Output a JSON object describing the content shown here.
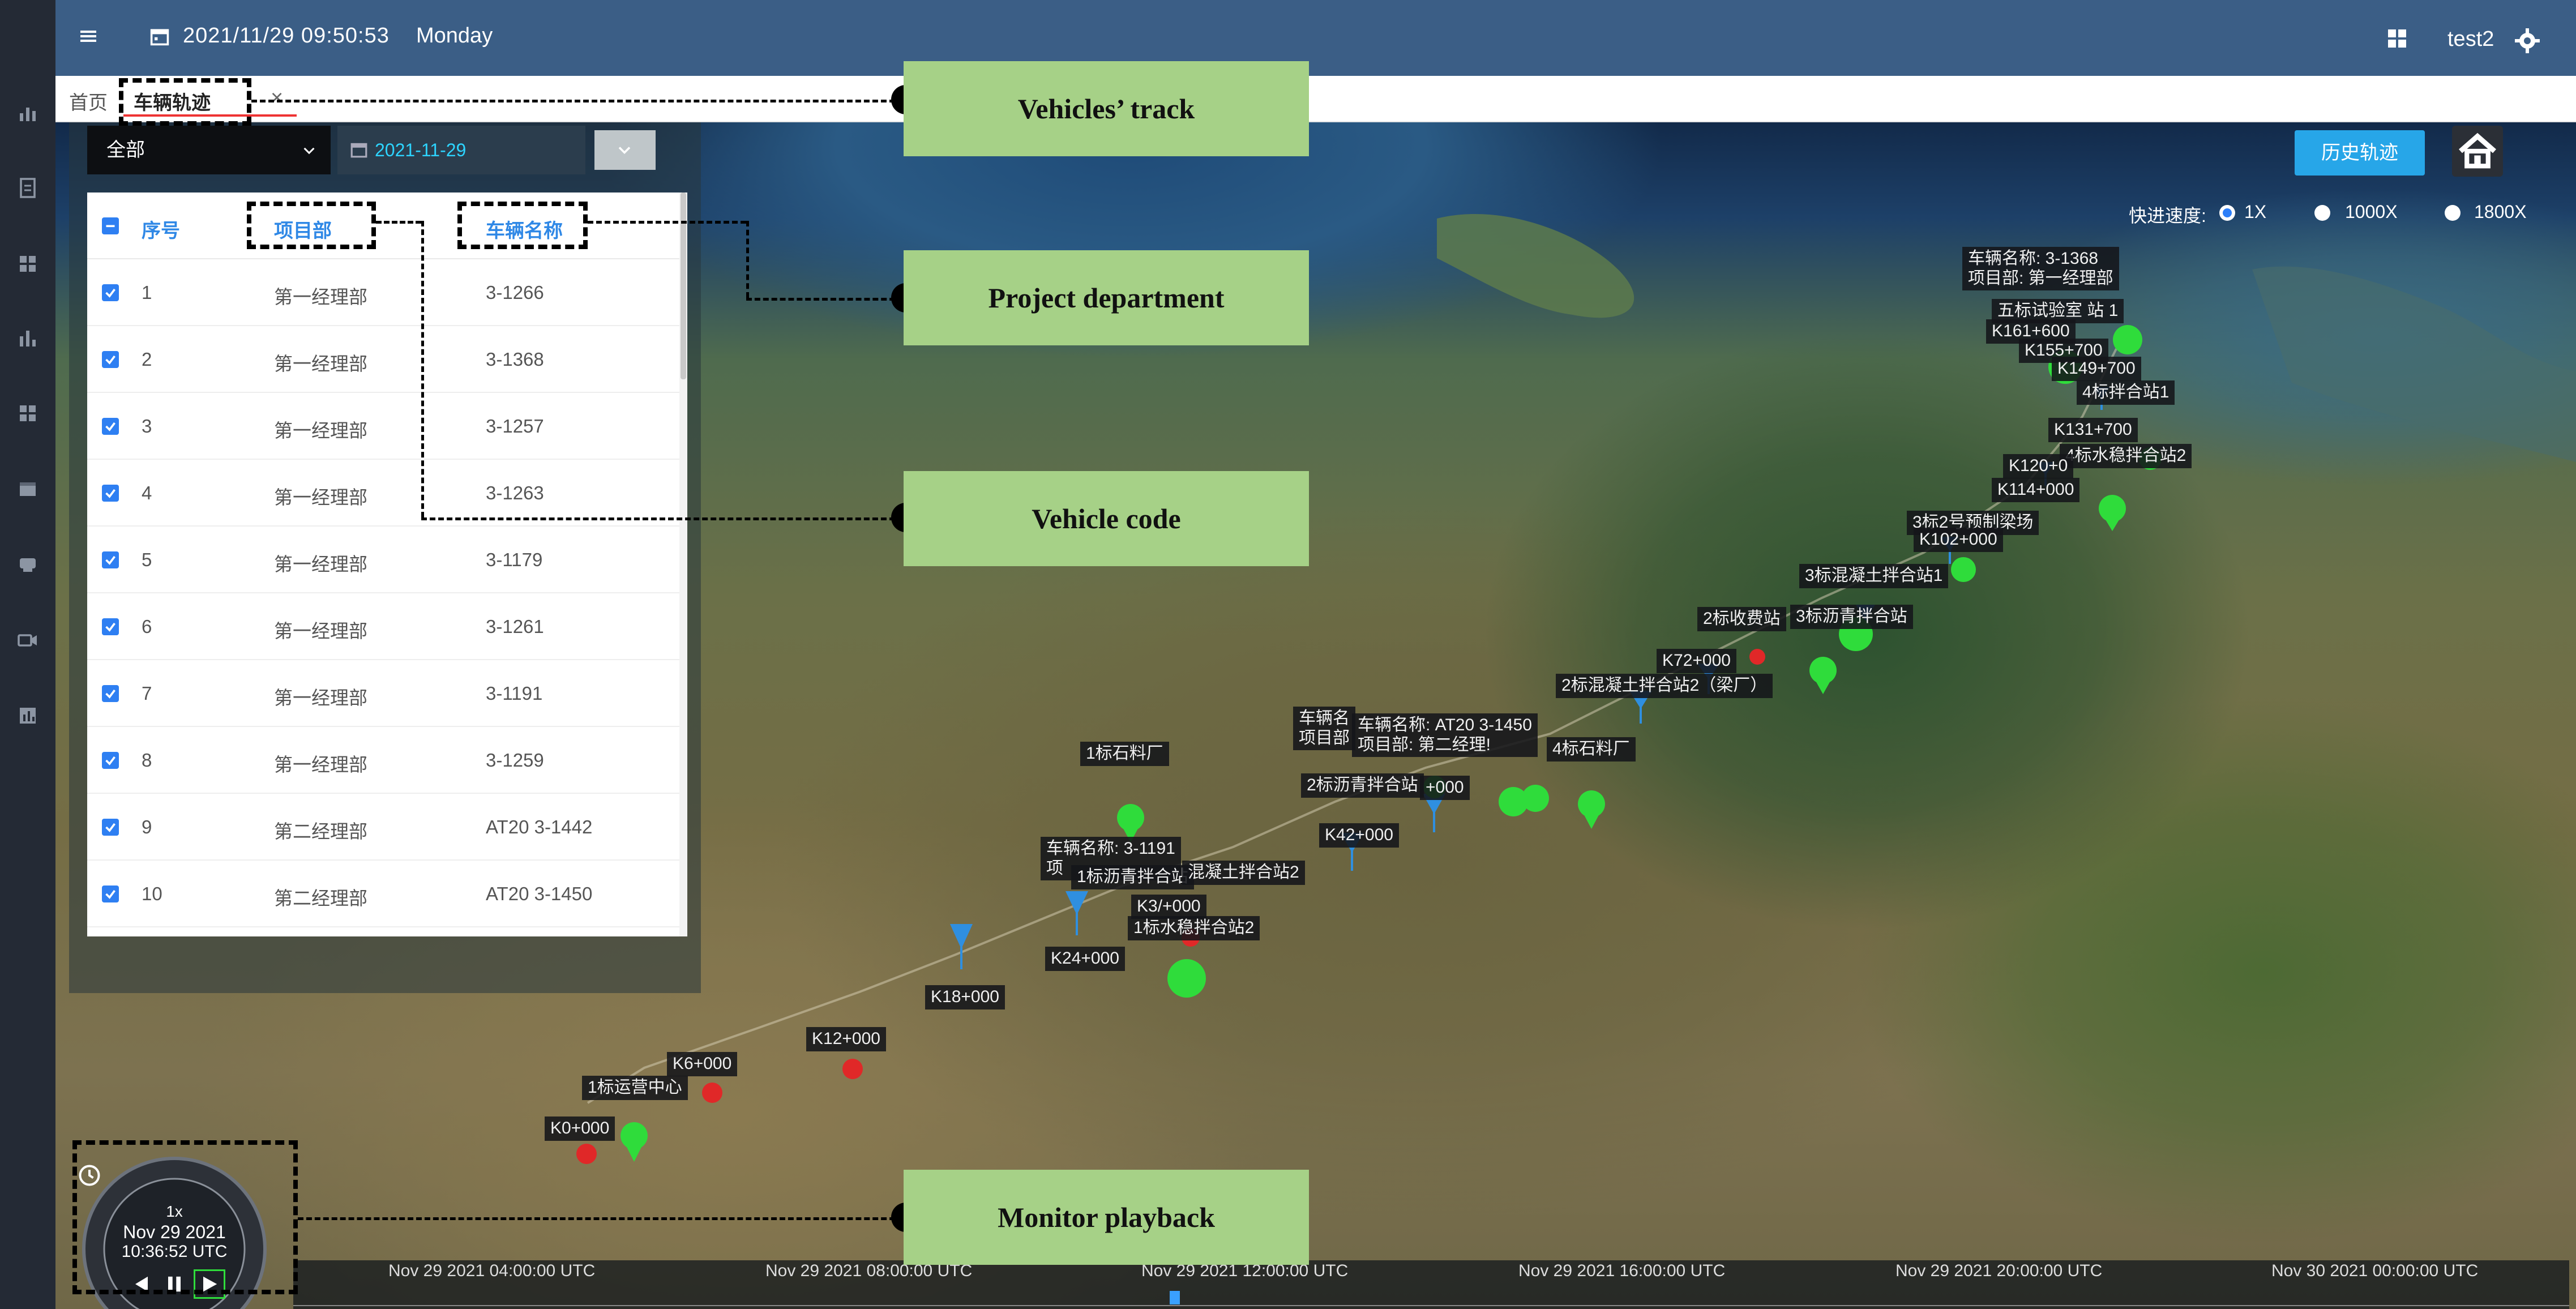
{
  "topbar": {
    "datetime": "2021/11/29  09:50:53",
    "weekday": "Monday",
    "user": "test2"
  },
  "tabs": {
    "home": "首页",
    "active": "车辆轨迹"
  },
  "filter": {
    "select_value": "全部",
    "date_value": "2021-11-29"
  },
  "map_controls": {
    "history_button": "历史轨迹",
    "speed_label": "快进速度:",
    "speed_options": [
      "1X",
      "1000X",
      "1800X"
    ],
    "speed_selected": "1X"
  },
  "table": {
    "headers": {
      "index": "序号",
      "department": "项目部",
      "vehicle": "车辆名称"
    },
    "rows": [
      {
        "index": "1",
        "department": "第一经理部",
        "vehicle": "3-1266"
      },
      {
        "index": "2",
        "department": "第一经理部",
        "vehicle": "3-1368"
      },
      {
        "index": "3",
        "department": "第一经理部",
        "vehicle": "3-1257"
      },
      {
        "index": "4",
        "department": "第一经理部",
        "vehicle": "3-1263"
      },
      {
        "index": "5",
        "department": "第一经理部",
        "vehicle": "3-1179"
      },
      {
        "index": "6",
        "department": "第一经理部",
        "vehicle": "3-1261"
      },
      {
        "index": "7",
        "department": "第一经理部",
        "vehicle": "3-1191"
      },
      {
        "index": "8",
        "department": "第一经理部",
        "vehicle": "3-1259"
      },
      {
        "index": "9",
        "department": "第二经理部",
        "vehicle": "AT20 3-1442"
      },
      {
        "index": "10",
        "department": "第二经理部",
        "vehicle": "AT20 3-1450"
      }
    ]
  },
  "playback": {
    "speed": "1x",
    "date": "Nov 29 2021",
    "time": "10:36:52 UTC"
  },
  "timeline": {
    "labels": [
      "Nov 29 2021 04:00:00 UTC",
      "Nov 29 2021 08:00:00 UTC",
      "Nov 29 2021 12:00:00 UTC",
      "Nov 29 2021 16:00:00 UTC",
      "Nov 29 2021 20:00:00 UTC",
      "Nov 30 2021 00:00:00 UTC"
    ]
  },
  "map_labels": {
    "vehicle_tooltip_1": {
      "name": "车辆名称:   3-1368",
      "dept": "项目部:      第一经理部"
    },
    "vehicle_tooltip_2": {
      "name": "车辆名称:   AT20 3-1450",
      "dept": "项目部:      第二经理!"
    },
    "vehicle_tooltip_3": {
      "name": "车辆名称:   3-1191",
      "dept": "项"
    },
    "vehicle_tooltip_4": {
      "name": "车辆名",
      "dept": "项目部"
    },
    "stations": [
      "五标试验室  站 1",
      "K161+600",
      "K155+700",
      "K149+700",
      "4标拌合站1",
      "K131+700",
      "4标水稳拌合站2",
      "K120+0",
      "K114+000",
      "3标2号预制梁场",
      "K102+000",
      "3标混凝土拌合站1",
      "2标收费站",
      "3标沥青拌合站",
      "K72+000",
      "2标混凝土拌合站2（梁厂）",
      "4标石料厂",
      "1标石料厂",
      "2标沥青拌合站",
      "+000",
      "K42+000",
      "1标沥青拌合站",
      "混凝土拌合站2",
      "K3/+000",
      "1标水稳拌合站2",
      "K24+000",
      "K18+000",
      "K12+000",
      "K6+000",
      "1标运营中心",
      "K0+000",
      "000"
    ]
  },
  "annotations": {
    "vehicles_track": "Vehicles’ track",
    "project_department": "Project department",
    "vehicle_code": "Vehicle code",
    "monitor_playback": "Monitor playback"
  },
  "colors": {
    "accent_blue": "#27a6e8",
    "topbar": "#3b5e86",
    "marker_green": "#2fdc3b",
    "marker_blue": "#2f8fe0",
    "marker_red": "#e02828",
    "annotation_green": "#a6d187"
  }
}
